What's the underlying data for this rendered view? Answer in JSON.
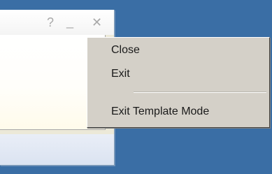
{
  "window": {
    "help_label": "?",
    "minimize_label": "_",
    "close_label": "✕"
  },
  "context_menu": {
    "items": [
      {
        "label": "Close"
      },
      {
        "label": "Exit"
      },
      {
        "label": "Exit Template Mode"
      }
    ]
  },
  "colors": {
    "desktop_background": "#3a6ea5",
    "menu_background": "#d4d0c8",
    "title_bar_button": "#a9a9a9"
  }
}
